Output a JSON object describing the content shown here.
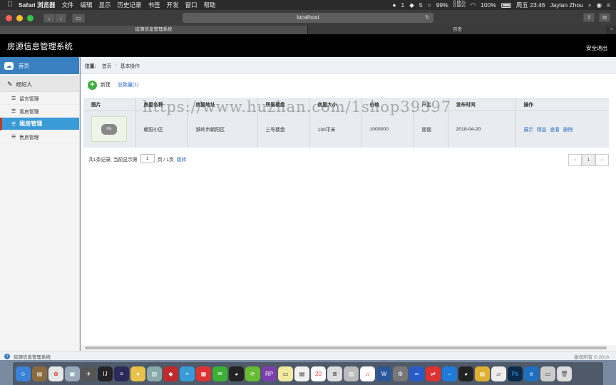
{
  "menubar": {
    "apple": "",
    "app_name": "Safari 浏览器",
    "menus": [
      "文件",
      "编辑",
      "显示",
      "历史记录",
      "书签",
      "开发",
      "窗口",
      "帮助"
    ],
    "status": {
      "notif_count": "1",
      "count5": "5",
      "battery_pct": "99%",
      "net_up": "0.6K/s",
      "net_down": "0.5K/s",
      "power": "100%",
      "datetime": "周五 23:46",
      "user": "Jaylan Zhou"
    }
  },
  "toolbar": {
    "url": "localhost",
    "back": "‹",
    "forward": "›",
    "reload": "↻"
  },
  "tabs": [
    {
      "label": "房源信息管理系统",
      "active": true
    },
    {
      "label": "百度",
      "active": false
    }
  ],
  "tab_add": "+",
  "header": {
    "title": "房源信息管理系统",
    "logout": "安全退出"
  },
  "sidebar": {
    "home": "首页",
    "group": "经纪人",
    "items": [
      {
        "label": "留言管理"
      },
      {
        "label": "看房管理"
      },
      {
        "label": "租房管理",
        "active": true
      },
      {
        "label": "售房管理"
      }
    ]
  },
  "breadcrumb": {
    "position_label": "位置:",
    "home": "首页",
    "separator": "›",
    "current": "基本操作"
  },
  "actions": {
    "new_label": "新建",
    "total_label": "总数量(1)"
  },
  "table": {
    "headers": [
      "图片",
      "房屋名称",
      "房屋地址",
      "所属楼盘",
      "房屋大小",
      "价格",
      "户主",
      "发布时间",
      "操作"
    ],
    "rows": [
      {
        "image_text": "Pix",
        "name": "朝阳小区",
        "address": "铁岭市朝阳区",
        "building": "三号楼盘",
        "size": "130平米",
        "price": "1000000",
        "owner": "丽丽",
        "date": "2018-04-20",
        "ops": [
          "展示",
          "精品",
          "查看",
          "删除"
        ]
      }
    ]
  },
  "pagination": {
    "summary": "共1条记录, 当前显示第",
    "page_value": "1",
    "total_pages": "页 / 1页",
    "jump": "跳转",
    "prev": "‹",
    "current": "1",
    "next": "›"
  },
  "watermark": "https://www.huzhan.com/1shop39397",
  "footer": {
    "left": "房源信息管理系统",
    "right": "版权所有 © 2018"
  },
  "dock_icons": [
    "finder",
    "notes",
    "photos",
    "preview",
    "launchpad",
    "intellij",
    "sequel",
    "bird",
    "db",
    "redis",
    "safari",
    "present",
    "wechat",
    "qq",
    "green",
    "rp",
    "notes2",
    "pages",
    "calendar",
    "text",
    "preview2",
    "music",
    "word",
    "system",
    "baidu",
    "teamviewer",
    "teamviewer2",
    "qq2",
    "stickies",
    "pages2",
    "photoshop",
    "edge",
    "folder",
    "trash"
  ]
}
